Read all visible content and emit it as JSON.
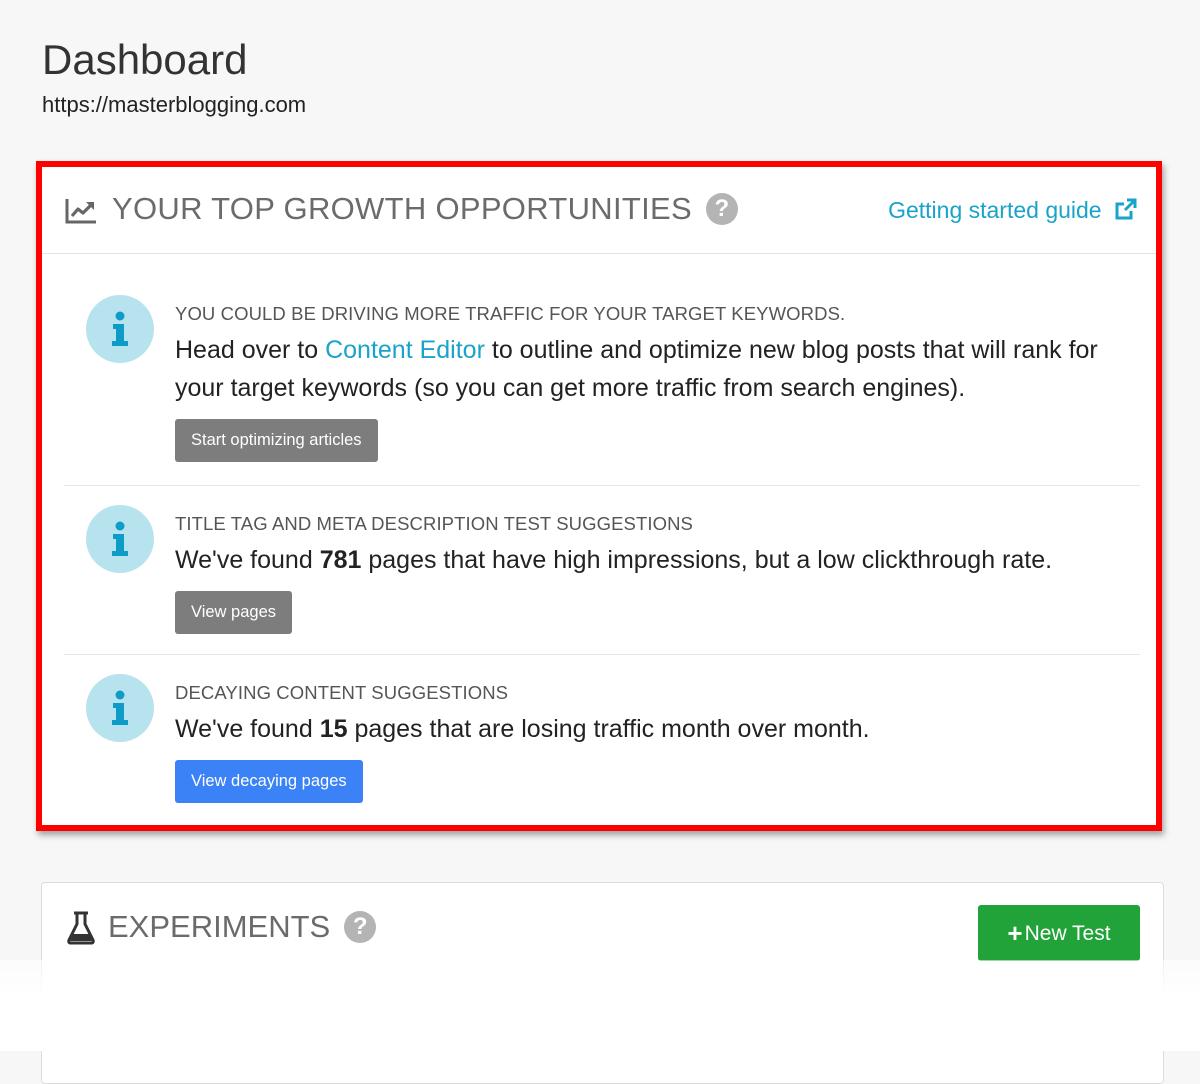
{
  "page": {
    "title": "Dashboard",
    "url": "https://masterblogging.com"
  },
  "growth_panel": {
    "title": "YOUR TOP GROWTH OPPORTUNITIES",
    "help_icon": "?",
    "guide_link": "Getting started guide",
    "icons": {
      "header": "trend-chart-icon",
      "guide": "external-link-icon",
      "item": "info-icon"
    },
    "colors": {
      "highlight_border": "#ff0000",
      "link": "#1aa3c9",
      "info_badge": "#b7e3ef",
      "gray_button": "#7d7d7d",
      "blue_button": "#3b82f6"
    },
    "items": [
      {
        "heading": "YOU COULD BE DRIVING MORE TRAFFIC FOR YOUR TARGET KEYWORDS.",
        "text_before": "Head over to ",
        "link_text": "Content Editor",
        "text_after": " to outline and optimize new blog posts that will rank for your target keywords (so you can get more traffic from search engines).",
        "button": "Start optimizing articles"
      },
      {
        "heading": "TITLE TAG AND META DESCRIPTION TEST SUGGESTIONS",
        "text_before": "We've found ",
        "count": "781",
        "text_after": " pages that have high impressions, but a low clickthrough rate.",
        "button": "View pages"
      },
      {
        "heading": "DECAYING CONTENT SUGGESTIONS",
        "text_before": "We've found ",
        "count": "15",
        "text_after": " pages that are losing traffic month over month.",
        "button": "View decaying pages"
      }
    ]
  },
  "experiments": {
    "title": "EXPERIMENTS",
    "help_icon": "?",
    "new_test_plus": "+",
    "new_test_label": "New Test",
    "icons": {
      "header": "flask-icon"
    },
    "colors": {
      "new_test_button": "#22a33a"
    }
  }
}
